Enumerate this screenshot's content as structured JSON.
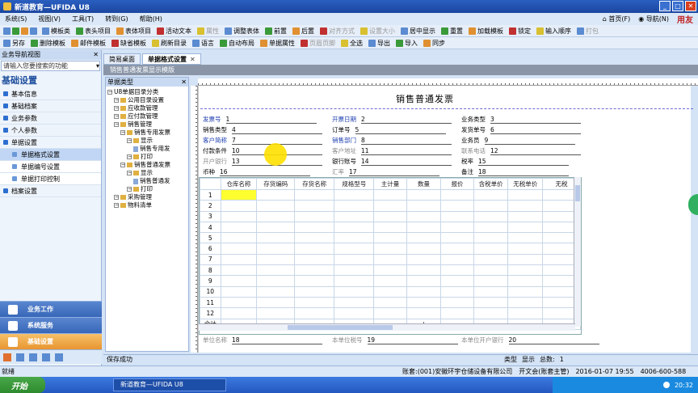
{
  "window": {
    "title": "新道教育—UFIDA U8"
  },
  "menu": {
    "items": [
      "系统(S)",
      "视图(V)",
      "工具(T)",
      "转到(G)",
      "帮助(H)"
    ],
    "home": "首页(F)",
    "nav": "导航(N)",
    "brand": "用友"
  },
  "toolbar1": [
    {
      "label": "模板类",
      "dis": false
    },
    {
      "label": "表头项目",
      "dis": false
    },
    {
      "label": "表体项目",
      "dis": false
    },
    {
      "label": "活动文本",
      "dis": false
    },
    {
      "label": "属性",
      "dis": true
    },
    {
      "label": "调整表体",
      "dis": false
    },
    {
      "label": "前置",
      "dis": false
    },
    {
      "label": "后置",
      "dis": false
    },
    {
      "label": "对齐方式",
      "dis": true
    },
    {
      "label": "设置大小",
      "dis": true
    },
    {
      "label": "居中显示",
      "dis": false
    },
    {
      "label": "重置",
      "dis": false
    },
    {
      "label": "加载模板",
      "dis": false
    },
    {
      "label": "锁定",
      "dis": false
    },
    {
      "label": "输入顺序",
      "dis": false
    },
    {
      "label": "打包",
      "dis": true
    }
  ],
  "toolbar2": [
    {
      "label": "另存",
      "dis": false
    },
    {
      "label": "删除模板",
      "dis": false
    },
    {
      "label": "邮件模板",
      "dis": false
    },
    {
      "label": "缺省模板",
      "dis": false
    },
    {
      "label": "刷新目录",
      "dis": false
    },
    {
      "label": "语言",
      "dis": false
    },
    {
      "label": "自动布局",
      "dis": false
    },
    {
      "label": "单据属性",
      "dis": false
    },
    {
      "label": "页眉页脚",
      "dis": true
    },
    {
      "label": "全选",
      "dis": false
    },
    {
      "label": "导出",
      "dis": false
    },
    {
      "label": "导入",
      "dis": false
    },
    {
      "label": "同步",
      "dis": false
    }
  ],
  "sidebar": {
    "header": "业务导航视图",
    "search_placeholder": "请输入您要搜索的功能",
    "title": "基础设置",
    "items": [
      {
        "label": "基本信息",
        "sub": false,
        "sel": false
      },
      {
        "label": "基础档案",
        "sub": false,
        "sel": false
      },
      {
        "label": "业务参数",
        "sub": false,
        "sel": false
      },
      {
        "label": "个人参数",
        "sub": false,
        "sel": false
      },
      {
        "label": "单据设置",
        "sub": false,
        "sel": false
      },
      {
        "label": "单据格式设置",
        "sub": true,
        "sel": true
      },
      {
        "label": "单据编号设置",
        "sub": true,
        "sel": false
      },
      {
        "label": "单据打印控制",
        "sub": true,
        "sel": false
      },
      {
        "label": "档案设置",
        "sub": false,
        "sel": false
      }
    ],
    "buttons": [
      {
        "label": "业务工作",
        "active": false
      },
      {
        "label": "系统服务",
        "active": false
      },
      {
        "label": "基础设置",
        "active": true
      }
    ]
  },
  "tabs": [
    {
      "label": "简易桌面",
      "active": false
    },
    {
      "label": "单据格式设置",
      "active": true
    }
  ],
  "subbar": {
    "text": "销售普通发票显示模版"
  },
  "tree": {
    "header": "单据类型",
    "nodes": [
      {
        "label": "U8单据目录分类",
        "level": 0,
        "kind": "pm"
      },
      {
        "label": "公用目录设置",
        "level": 1,
        "kind": "pm"
      },
      {
        "label": "应收款管理",
        "level": 1,
        "kind": "pm"
      },
      {
        "label": "应付款管理",
        "level": 1,
        "kind": "pm"
      },
      {
        "label": "销售管理",
        "level": 1,
        "kind": "pm"
      },
      {
        "label": "销售专用发票",
        "level": 2,
        "kind": "pm"
      },
      {
        "label": "显示",
        "level": 3,
        "kind": "pm"
      },
      {
        "label": "销售专用发",
        "level": 4,
        "kind": "doc"
      },
      {
        "label": "打印",
        "level": 3,
        "kind": "pm"
      },
      {
        "label": "销售普通发票",
        "level": 2,
        "kind": "pm"
      },
      {
        "label": "显示",
        "level": 3,
        "kind": "pm"
      },
      {
        "label": "销售普通发",
        "level": 4,
        "kind": "doc"
      },
      {
        "label": "打印",
        "level": 3,
        "kind": "pm"
      },
      {
        "label": "采购管理",
        "level": 1,
        "kind": "pm"
      },
      {
        "label": "物料清单",
        "level": 1,
        "kind": "pm"
      }
    ]
  },
  "form": {
    "title": "销售普通发票",
    "fields": [
      {
        "label": "发票号",
        "value": "1",
        "style": "blue"
      },
      {
        "label": "开票日期",
        "value": "2",
        "style": "blue"
      },
      {
        "label": "业务类型",
        "value": "3",
        "style": ""
      },
      {
        "label": "销售类型",
        "value": "4",
        "style": ""
      },
      {
        "label": "订单号",
        "value": "5",
        "style": ""
      },
      {
        "label": "发货单号",
        "value": "6",
        "style": ""
      },
      {
        "label": "客户简称",
        "value": "7",
        "style": "blue"
      },
      {
        "label": "销售部门",
        "value": "8",
        "style": "blue"
      },
      {
        "label": "业务员",
        "value": "9",
        "style": ""
      },
      {
        "label": "付款条件",
        "value": "10",
        "style": ""
      },
      {
        "label": "客户地址",
        "value": "11",
        "style": "gray"
      },
      {
        "label": "联系电话",
        "value": "12",
        "style": "gray"
      },
      {
        "label": "开户银行",
        "value": "13",
        "style": "gray"
      },
      {
        "label": "银行账号",
        "value": "14",
        "style": ""
      },
      {
        "label": "税率",
        "value": "15",
        "style": ""
      },
      {
        "label": "币种",
        "value": "16",
        "style": ""
      },
      {
        "label": "汇率",
        "value": "17",
        "style": "gray"
      },
      {
        "label": "备注",
        "value": "18",
        "style": ""
      }
    ],
    "footer_fields": [
      {
        "label": "单位名称",
        "value": "18"
      },
      {
        "label": "本单位税号",
        "value": "19"
      },
      {
        "label": "本单位开户银行",
        "value": "20"
      }
    ]
  },
  "grid": {
    "columns": [
      "仓库名称",
      "存货编码",
      "存货名称",
      "规格型号",
      "主计量",
      "数量",
      "报价",
      "含税单价",
      "无税单价",
      "无税"
    ],
    "rows": [
      "1",
      "2",
      "3",
      "4",
      "5",
      "6",
      "7",
      "8",
      "9",
      "10",
      "11",
      "12"
    ],
    "total_label": "合计",
    "plus": "+"
  },
  "status": {
    "left": "保存成功",
    "type_label": "类型",
    "type_value": "显示",
    "total_label": "总数:",
    "total_value": "1"
  },
  "app_status": {
    "left": "就绪",
    "account": "账套:(001)安徽环宇仓储设备有限公司",
    "user": "开文会(账套主管)",
    "datetime": "2016-01-07 19:55",
    "phone": "4006-600-588"
  },
  "taskbar": {
    "start": "开始",
    "item": "新道教育—UFIDA U8",
    "time": "20:32"
  }
}
